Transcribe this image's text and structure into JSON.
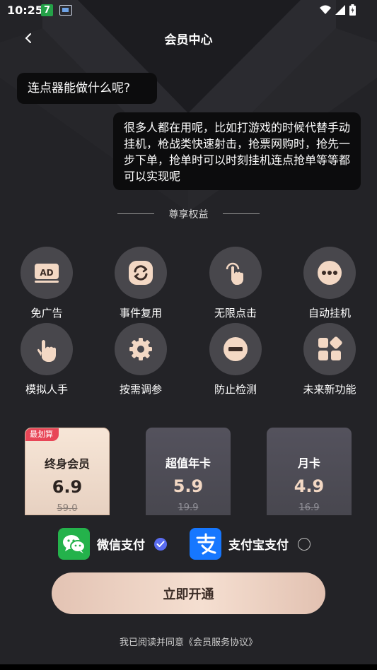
{
  "status_bar": {
    "time": "10:25",
    "notification_badge": "7"
  },
  "header": {
    "title": "会员中心"
  },
  "chat": {
    "question": "连点器能做什么呢?",
    "answer": "很多人都在用呢，比如打游戏的时候代替手动挂机，枪战类快速射击，抢票网购时，抢先一步下单，抢单时可以时刻挂机连点抢单等等都可以实现呢"
  },
  "benefits": {
    "heading": "尊享权益",
    "items": [
      {
        "label": "免广告",
        "icon": "ad-icon"
      },
      {
        "label": "事件复用",
        "icon": "refresh-icon"
      },
      {
        "label": "无限点击",
        "icon": "tap-icon"
      },
      {
        "label": "自动挂机",
        "icon": "more-icon"
      },
      {
        "label": "模拟人手",
        "icon": "hand-icon"
      },
      {
        "label": "按需调参",
        "icon": "gear-icon"
      },
      {
        "label": "防止检测",
        "icon": "block-icon"
      },
      {
        "label": "未来新功能",
        "icon": "apps-icon"
      }
    ]
  },
  "plans": [
    {
      "name": "终身会员",
      "price": "6.9",
      "original": "59.0",
      "tag": "最划算",
      "selected": true
    },
    {
      "name": "超值年卡",
      "price": "5.9",
      "original": "19.9",
      "selected": false
    },
    {
      "name": "月卡",
      "price": "4.9",
      "original": "16.9",
      "selected": false
    }
  ],
  "payment": {
    "wechat_label": "微信支付",
    "alipay_label": "支付宝支付",
    "selected": "wechat"
  },
  "action": {
    "button_label": "立即开通"
  },
  "agreement": {
    "prefix": "我已阅读并同意",
    "link": "《会员服务协议》"
  },
  "colors": {
    "background": "#232327",
    "bubble": "#0c0c0d",
    "accent_gold": "#f5dfd1",
    "tag_red": "#e84657",
    "wechat_green": "#24b24b",
    "alipay_blue": "#1677ff",
    "radio_blue": "#5a6cf0"
  }
}
